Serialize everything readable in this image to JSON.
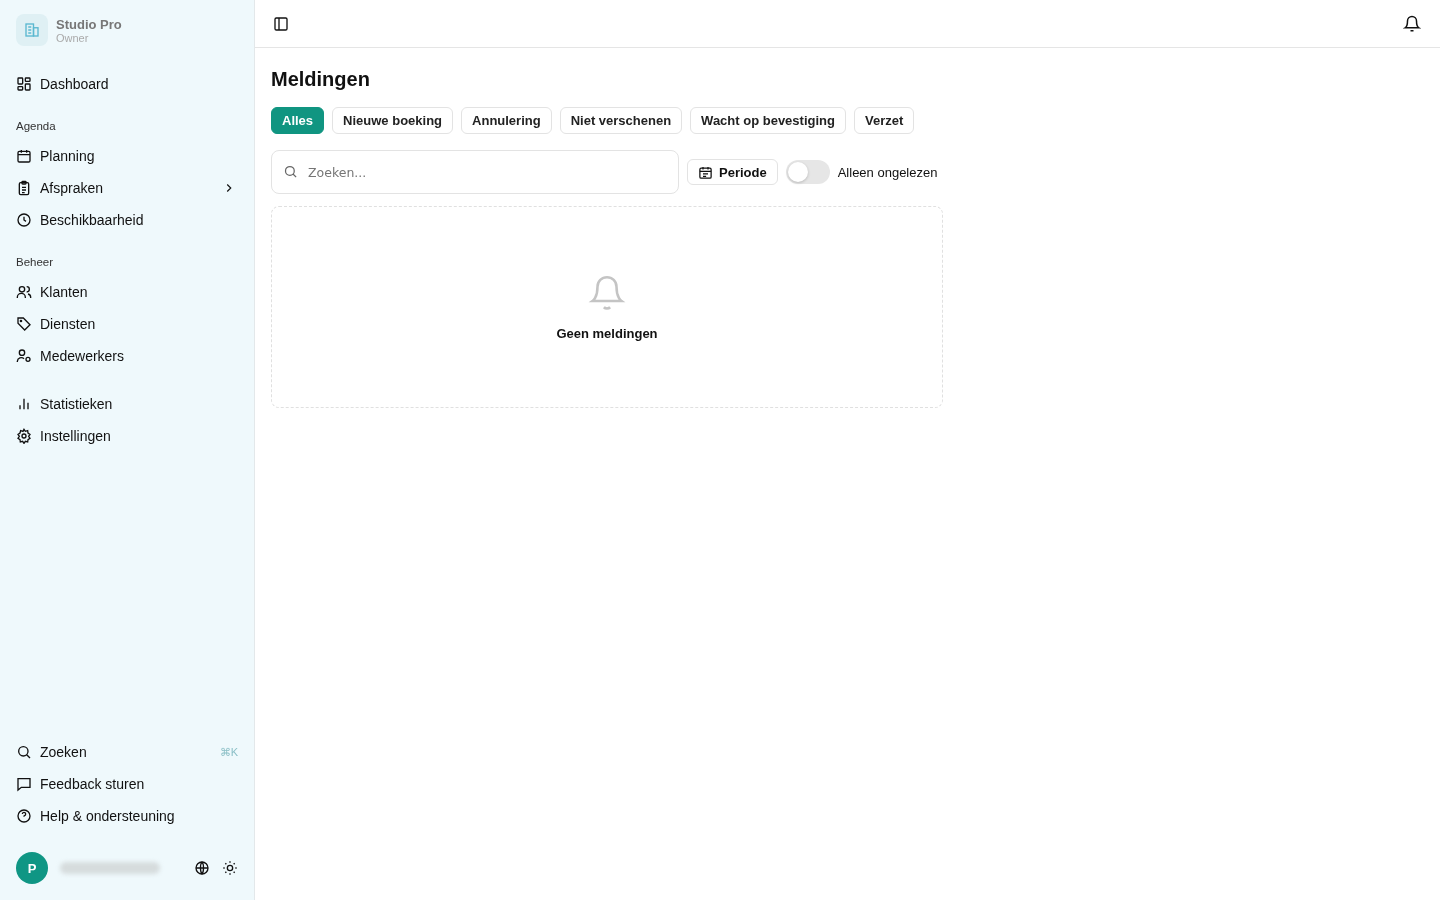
{
  "workspace": {
    "name": "Studio Pro",
    "role": "Owner"
  },
  "nav_top": [
    {
      "label": "Dashboard"
    }
  ],
  "nav_groups": [
    {
      "heading": "Agenda",
      "items": [
        {
          "label": "Planning",
          "expandable": false
        },
        {
          "label": "Afspraken",
          "expandable": true
        },
        {
          "label": "Beschikbaarheid",
          "expandable": false
        }
      ]
    },
    {
      "heading": "Beheer",
      "items": [
        {
          "label": "Klanten",
          "expandable": false
        },
        {
          "label": "Diensten",
          "expandable": false
        },
        {
          "label": "Medewerkers",
          "expandable": false
        }
      ]
    },
    {
      "items": [
        {
          "label": "Statistieken",
          "expandable": false
        },
        {
          "label": "Instellingen",
          "expandable": false
        }
      ]
    }
  ],
  "nav_bottom": [
    {
      "label": "Zoeken",
      "shortcut": "⌘K"
    },
    {
      "label": "Feedback sturen"
    },
    {
      "label": "Help & ondersteuning"
    }
  ],
  "user": {
    "initial": "P"
  },
  "page": {
    "title": "Meldingen",
    "filters": [
      {
        "label": "Alles",
        "selected": true
      },
      {
        "label": "Nieuwe boeking",
        "selected": false
      },
      {
        "label": "Annulering",
        "selected": false
      },
      {
        "label": "Niet verschenen",
        "selected": false
      },
      {
        "label": "Wacht op bevestiging",
        "selected": false
      },
      {
        "label": "Verzet",
        "selected": false
      }
    ],
    "search": {
      "placeholder": "Zoeken..."
    },
    "period_button": "Periode",
    "unread_toggle": {
      "label": "Alleen ongelezen",
      "on": false
    },
    "empty_state": "Geen meldingen"
  }
}
